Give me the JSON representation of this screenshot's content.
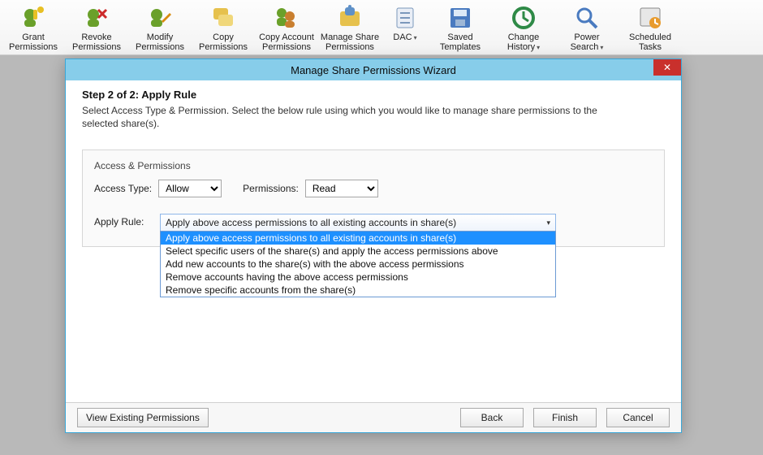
{
  "ribbon": [
    {
      "label1": "Grant",
      "label2": "Permissions",
      "drop": false
    },
    {
      "label1": "Revoke",
      "label2": "Permissions",
      "drop": false
    },
    {
      "label1": "Modify",
      "label2": "Permissions",
      "drop": false
    },
    {
      "label1": "Copy",
      "label2": "Permissions",
      "drop": false
    },
    {
      "label1": "Copy Account",
      "label2": "Permissions",
      "drop": false
    },
    {
      "label1": "Manage Share",
      "label2": "Permissions",
      "drop": false
    },
    {
      "label1": "DAC",
      "label2": "",
      "drop": true
    },
    {
      "label1": "Saved",
      "label2": "Templates",
      "drop": false
    },
    {
      "label1": "Change",
      "label2": "History",
      "drop": true
    },
    {
      "label1": "Power",
      "label2": "Search",
      "drop": true
    },
    {
      "label1": "Scheduled",
      "label2": "Tasks",
      "drop": false
    }
  ],
  "modal": {
    "title": "Manage Share Permissions Wizard",
    "step_title": "Step 2 of 2: Apply Rule",
    "step_desc": "Select Access Type & Permission. Select the below rule using which you would like to manage share permissions to the selected share(s).",
    "group_title": "Access & Permissions",
    "access_type_label": "Access Type:",
    "access_type_value": "Allow",
    "permissions_label": "Permissions:",
    "permissions_value": "Read",
    "apply_label": "Apply Rule:",
    "apply_selected": "Apply above access permissions to all existing accounts in share(s)",
    "apply_options": [
      "Apply above access permissions to all existing accounts in share(s)",
      "Select specific users of the share(s) and apply the access permissions above",
      "Add new accounts to the share(s) with the above access permissions",
      "Remove accounts having the above access permissions",
      "Remove specific accounts from the share(s)"
    ],
    "view_existing": "View Existing Permissions",
    "back": "Back",
    "finish": "Finish",
    "cancel": "Cancel"
  }
}
